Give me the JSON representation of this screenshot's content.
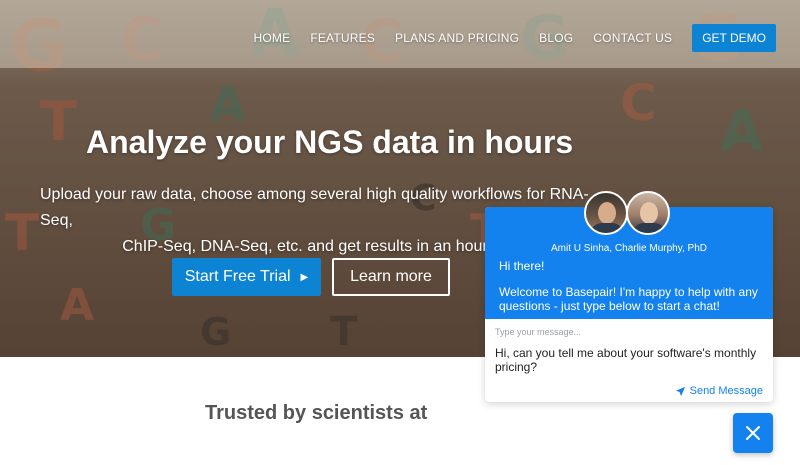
{
  "nav": {
    "items": [
      "HOME",
      "FEATURES",
      "PLANS AND PRICING",
      "BLOG",
      "CONTACT US"
    ],
    "cta": "GET DEMO"
  },
  "hero": {
    "title": "Analyze your NGS data in hours",
    "subtitle_line1": "Upload your raw data, choose among several high quality workflows for RNA-Seq,",
    "subtitle_line2": "ChIP-Seq, DNA-Seq, etc. and get results in an hour",
    "primary_button": "Start Free Trial",
    "secondary_button": "Learn more"
  },
  "trusted": {
    "heading": "Trusted by scientists at"
  },
  "chat": {
    "agents": "Amit U Sinha, Charlie Murphy, PhD",
    "greeting": "Hi there!",
    "welcome": "Welcome to Basepair! I'm happy to help with any questions - just type below to start a chat!",
    "placeholder": "Type your message...",
    "message": "Hi, can you tell me about your software's monthly pricing?",
    "send_label": "Send Message"
  },
  "colors": {
    "accent": "#0d83d3",
    "chat_blue": "#1382ef"
  },
  "icons": {
    "primary_arrow": "caret-right-icon",
    "send": "paper-plane-icon",
    "close": "close-icon"
  }
}
